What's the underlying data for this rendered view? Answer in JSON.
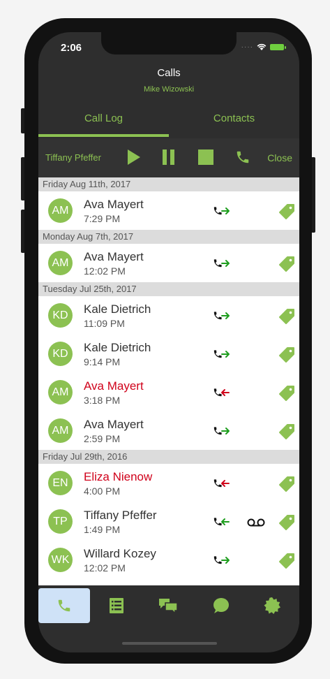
{
  "status": {
    "time": "2:06"
  },
  "header": {
    "title": "Calls",
    "subtitle": "Mike Wizowski"
  },
  "tabs": [
    {
      "label": "Call Log"
    },
    {
      "label": "Contacts"
    }
  ],
  "player": {
    "name": "Tiffany Pfeffer",
    "close_label": "Close"
  },
  "sections": [
    {
      "date": "Friday Aug 11th, 2017",
      "calls": [
        {
          "initials": "AM",
          "name": "Ava Mayert",
          "time": "7:29 PM",
          "direction": "outgoing",
          "missed": false,
          "voicemail": false
        }
      ]
    },
    {
      "date": "Monday Aug 7th, 2017",
      "calls": [
        {
          "initials": "AM",
          "name": "Ava Mayert",
          "time": "12:02 PM",
          "direction": "outgoing",
          "missed": false,
          "voicemail": false
        }
      ]
    },
    {
      "date": "Tuesday Jul 25th, 2017",
      "calls": [
        {
          "initials": "KD",
          "name": "Kale Dietrich",
          "time": "11:09 PM",
          "direction": "outgoing",
          "missed": false,
          "voicemail": false
        },
        {
          "initials": "KD",
          "name": "Kale Dietrich",
          "time": "9:14 PM",
          "direction": "outgoing",
          "missed": false,
          "voicemail": false
        },
        {
          "initials": "AM",
          "name": "Ava Mayert",
          "time": "3:18 PM",
          "direction": "incoming",
          "missed": true,
          "voicemail": false
        },
        {
          "initials": "AM",
          "name": "Ava Mayert",
          "time": "2:59 PM",
          "direction": "outgoing",
          "missed": false,
          "voicemail": false
        }
      ]
    },
    {
      "date": "Friday Jul 29th, 2016",
      "calls": [
        {
          "initials": "EN",
          "name": "Eliza Nienow",
          "time": "4:00 PM",
          "direction": "incoming",
          "missed": true,
          "voicemail": false
        },
        {
          "initials": "TP",
          "name": "Tiffany Pfeffer",
          "time": "1:49 PM",
          "direction": "incoming",
          "missed": false,
          "voicemail": true
        },
        {
          "initials": "WK",
          "name": "Willard Kozey",
          "time": "12:02 PM",
          "direction": "outgoing",
          "missed": false,
          "voicemail": false
        }
      ]
    }
  ],
  "bottom_nav": [
    {
      "icon": "phone-icon",
      "active": true
    },
    {
      "icon": "list-icon",
      "active": false
    },
    {
      "icon": "chats-icon",
      "active": false
    },
    {
      "icon": "chat-bubble-icon",
      "active": false
    },
    {
      "icon": "badge-icon",
      "active": false
    }
  ],
  "colors": {
    "accent": "#8cc152",
    "missed": "#d0021b",
    "outgoing_arrow": "#1e9e1e",
    "incoming_missed_arrow": "#d0021b",
    "incoming_arrow": "#1e9e1e",
    "active_nav": "#cfe2f7"
  }
}
